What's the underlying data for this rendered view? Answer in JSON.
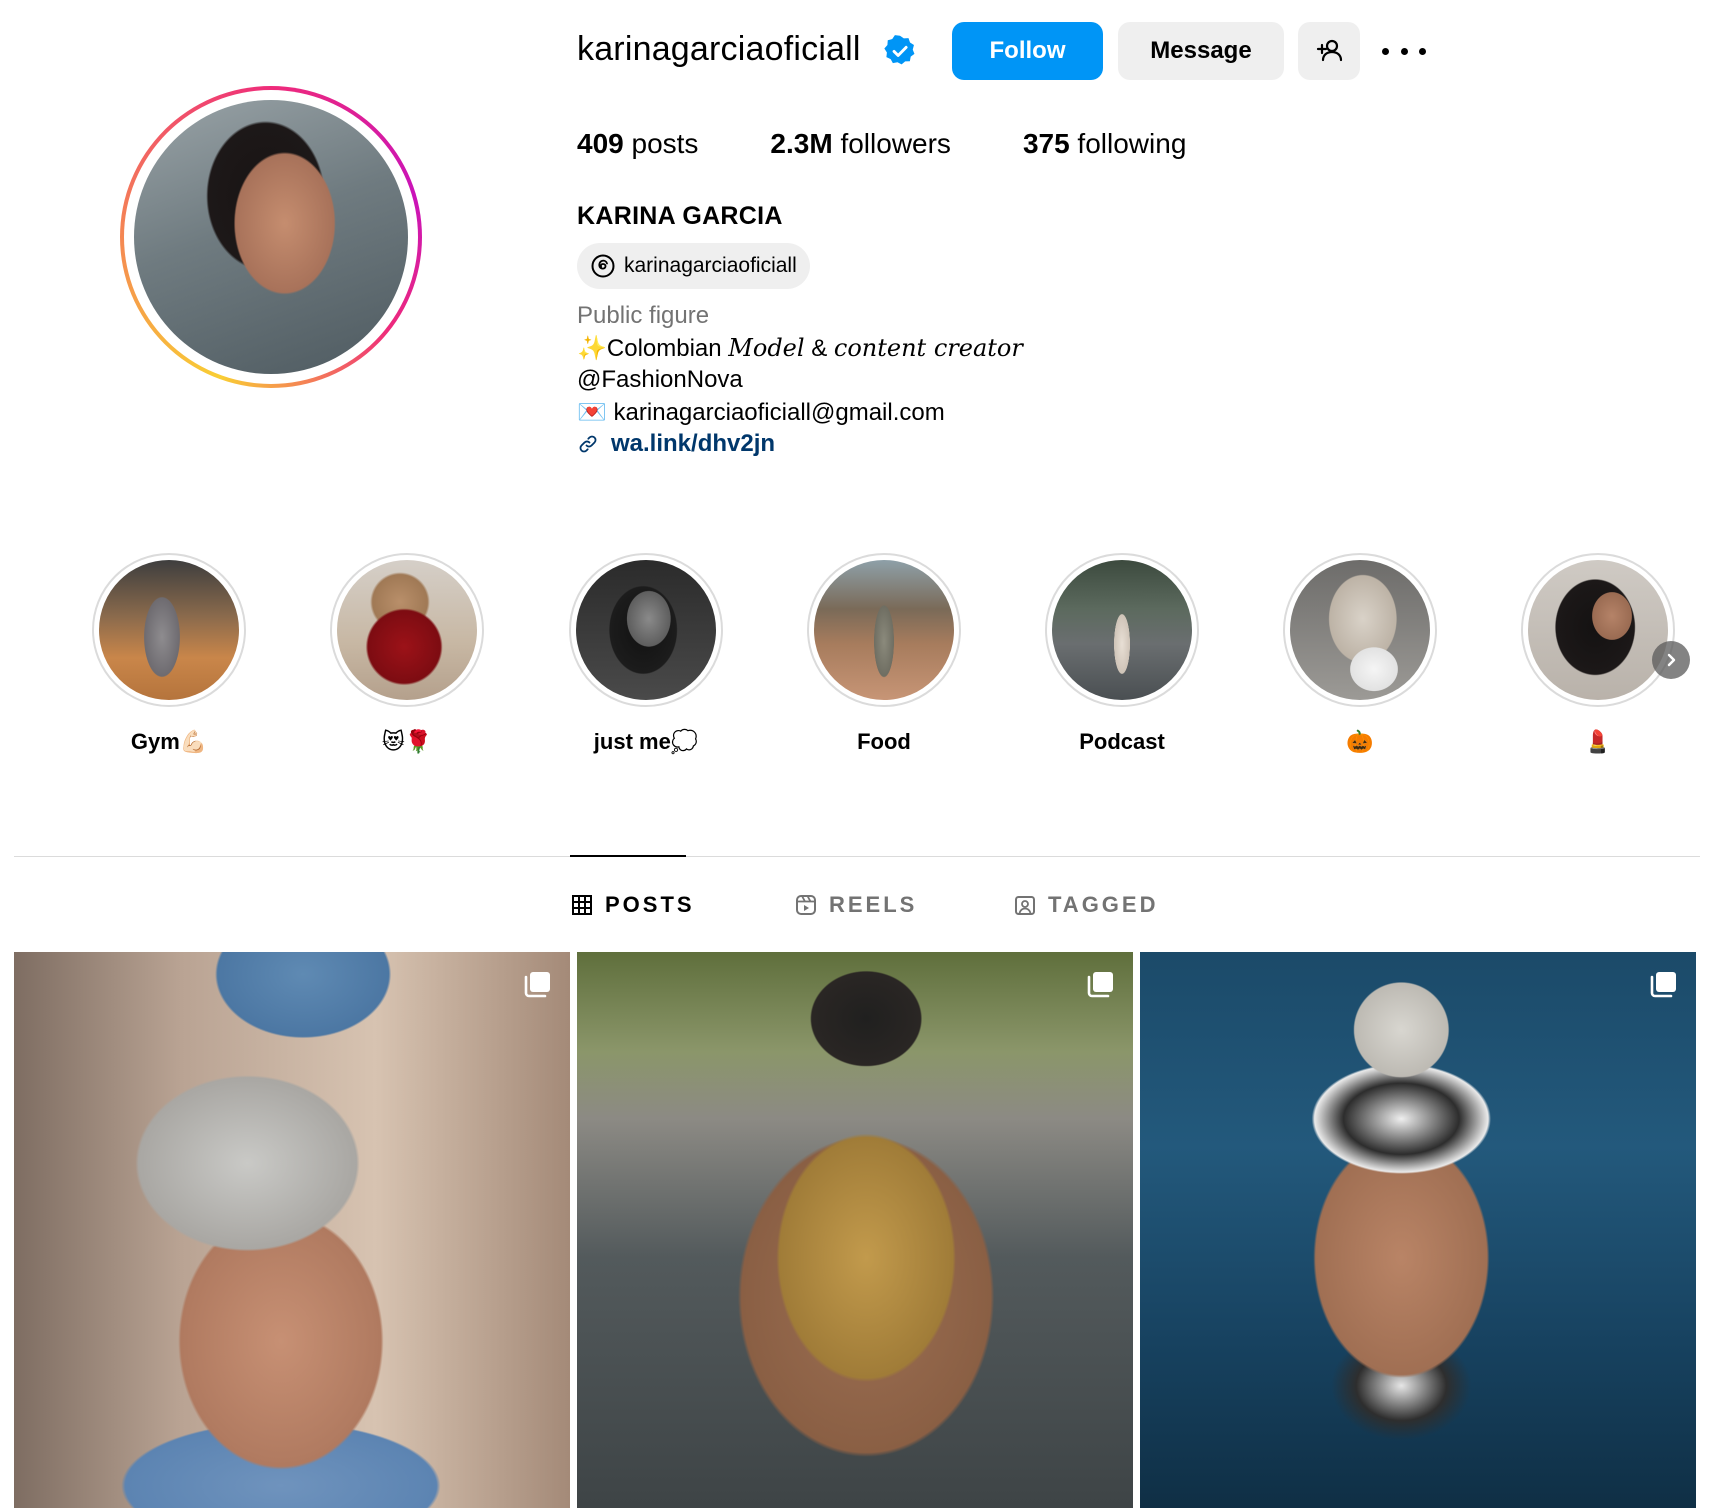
{
  "profile": {
    "username": "karinagarciaoficiall",
    "verified_icon": "verified-badge-icon",
    "buttons": {
      "follow": "Follow",
      "message": "Message",
      "add_user_icon": "add-user-icon",
      "more_icon": "more-options-icon"
    },
    "stats": {
      "posts_count": "409",
      "posts_label": " posts",
      "followers_count": "2.3M",
      "followers_label": " followers",
      "following_count": "375",
      "following_label": " following"
    },
    "full_name": "KARINA GARCIA",
    "threads_handle": "karinagarciaoficiall",
    "category": "Public figure",
    "bio": {
      "line1_emoji": "✨",
      "line1_a": "Colombian ",
      "line1_b": "Model",
      "line1_c": " & ",
      "line1_d": "content creator",
      "line2": "@FashionNova",
      "line3_emoji": "💌",
      "line3": " karinagarciaoficiall@gmail.com",
      "link": "wa.link/dhv2jn"
    }
  },
  "highlights": [
    {
      "label": "Gym💪🏻"
    },
    {
      "label": "😻🌹"
    },
    {
      "label": "just me💭"
    },
    {
      "label": "Food"
    },
    {
      "label": "Podcast"
    },
    {
      "label": "🎃"
    },
    {
      "label": "💄"
    }
  ],
  "tabs": [
    {
      "label": "POSTS",
      "icon": "grid-icon",
      "active": true
    },
    {
      "label": "REELS",
      "icon": "reels-icon",
      "active": false
    },
    {
      "label": "TAGGED",
      "icon": "tagged-icon",
      "active": false
    }
  ],
  "posts": [
    {
      "type_icon": "carousel-icon"
    },
    {
      "type_icon": "carousel-icon"
    },
    {
      "type_icon": "carousel-icon"
    }
  ],
  "colors": {
    "accent": "#0095f6",
    "secondary_button": "#efefef",
    "link": "#00376b",
    "muted_text": "#737373",
    "divider": "#dbdbdb"
  }
}
